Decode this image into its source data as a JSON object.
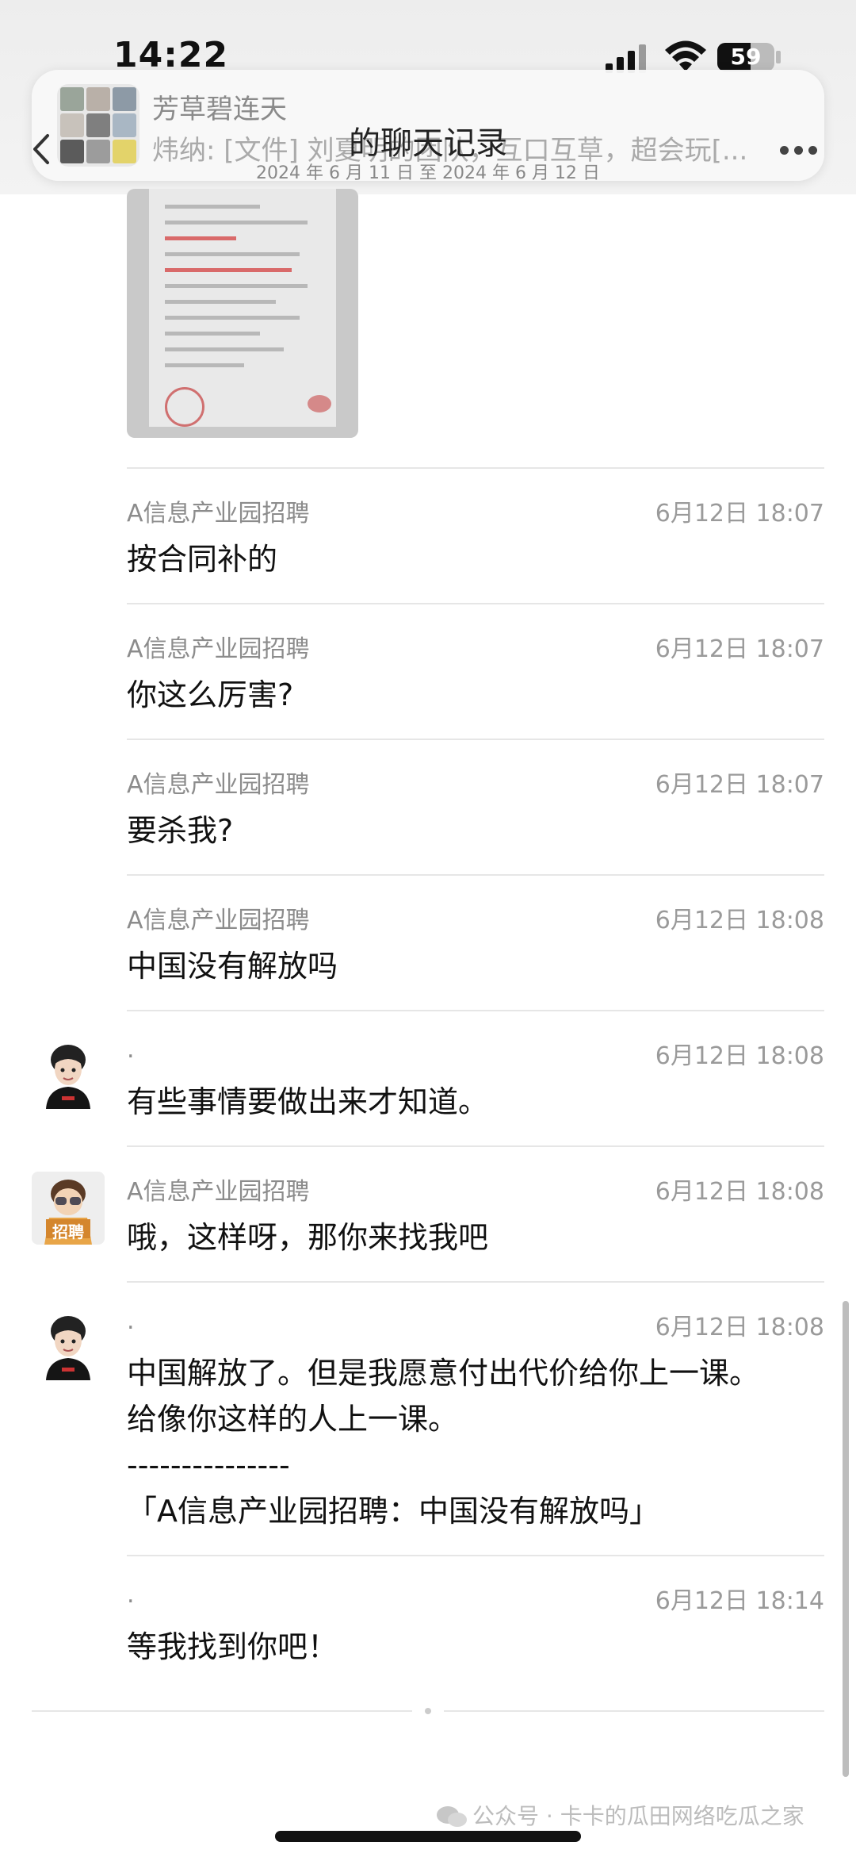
{
  "status_bar": {
    "time": "14:22",
    "battery": "59",
    "battery_level": 0.59
  },
  "banner": {
    "group_name": "芳草碧连天",
    "last_message": "炜纳: [文件] 刘夏明的团队，互口互草，超会玩[..."
  },
  "nav": {
    "title": "的聊天记录",
    "subtitle": "2024 年 6 月 11 日 至 2024 年 6 月 12 日"
  },
  "messages": [
    {
      "sender": "A信息产业园招聘",
      "time": "6月12日 18:07",
      "text": "按合同补的"
    },
    {
      "sender": "A信息产业园招聘",
      "time": "6月12日 18:07",
      "text": "你这么厉害?"
    },
    {
      "sender": "A信息产业园招聘",
      "time": "6月12日 18:07",
      "text": "要杀我?"
    },
    {
      "sender": "A信息产业园招聘",
      "time": "6月12日 18:08",
      "text": "中国没有解放吗"
    },
    {
      "sender": ".",
      "time": "6月12日 18:08",
      "text": "有些事情要做出来才知道。"
    },
    {
      "sender": "A信息产业园招聘",
      "time": "6月12日 18:08",
      "text": "哦，这样呀，那你来找我吧"
    },
    {
      "sender": ".",
      "time": "6月12日 18:08",
      "text": "中国解放了。但是我愿意付出代价给你上一课。\n给像你这样的人上一课。\n---------------\n「A信息产业园招聘：中国没有解放吗」"
    },
    {
      "sender": ".",
      "time": "6月12日 18:14",
      "text": "等我找到你吧！"
    }
  ],
  "avatars": {
    "recruiter_badge": "招聘"
  },
  "watermark": "公众号 · 卡卡的瓜田网络吃瓜之家"
}
